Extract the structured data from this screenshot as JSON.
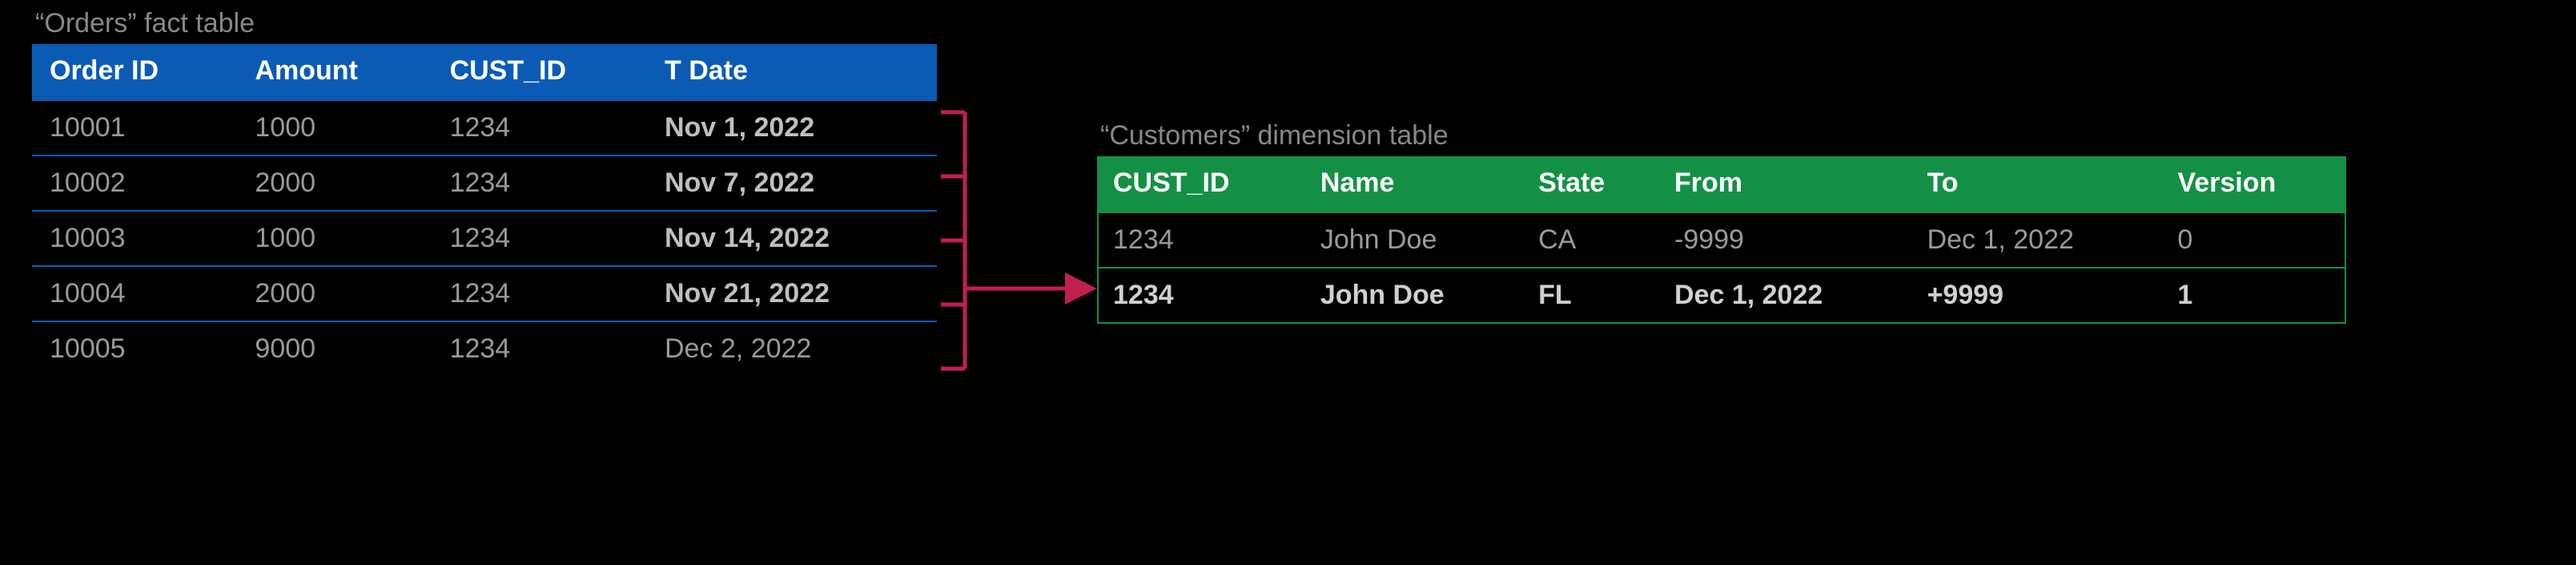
{
  "orders": {
    "caption": "“Orders” fact table",
    "headers": [
      "Order ID",
      "Amount",
      "CUST_ID",
      "T Date"
    ],
    "rows": [
      {
        "order_id": "10001",
        "amount": "1000",
        "cust_id": "1234",
        "t_date": "Nov 1, 2022",
        "date_bold": true
      },
      {
        "order_id": "10002",
        "amount": "2000",
        "cust_id": "1234",
        "t_date": "Nov 7, 2022",
        "date_bold": true
      },
      {
        "order_id": "10003",
        "amount": "1000",
        "cust_id": "1234",
        "t_date": "Nov 14, 2022",
        "date_bold": true
      },
      {
        "order_id": "10004",
        "amount": "2000",
        "cust_id": "1234",
        "t_date": "Nov 21, 2022",
        "date_bold": true
      },
      {
        "order_id": "10005",
        "amount": "9000",
        "cust_id": "1234",
        "t_date": "Dec 2, 2022",
        "date_bold": false
      }
    ]
  },
  "customers": {
    "caption": "“Customers” dimension table",
    "headers": [
      "CUST_ID",
      "Name",
      "State",
      "From",
      "To",
      "Version"
    ],
    "rows": [
      {
        "cust_id": "1234",
        "name": "John Doe",
        "state": "CA",
        "from": "-9999",
        "to": "Dec 1, 2022",
        "version": "0",
        "highlight": false
      },
      {
        "cust_id": "1234",
        "name": "John Doe",
        "state": "FL",
        "from": "Dec 1, 2022",
        "to": "+9999",
        "version": "1",
        "highlight": true
      }
    ]
  },
  "relation": {
    "arrow_color": "#c02050",
    "description": "foreign-key CUST_ID joins Orders rows to Customers dimension row"
  }
}
